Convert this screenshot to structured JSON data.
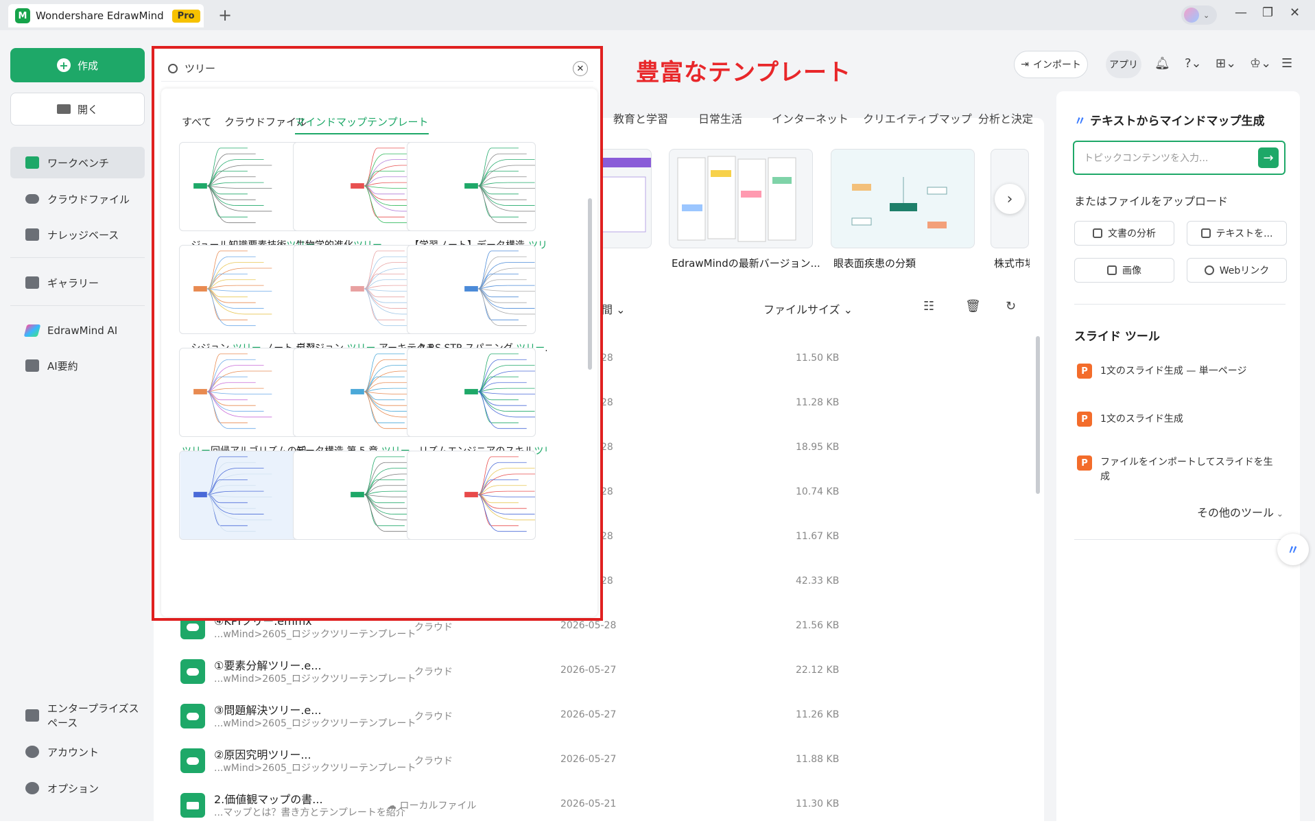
{
  "app": {
    "title": "Wondershare EdrawMind",
    "badge": "Pro"
  },
  "sidebar": {
    "create_label": "作成",
    "open_label": "開く",
    "items": [
      {
        "label": "ワークベンチ"
      },
      {
        "label": "クラウドファイル"
      },
      {
        "label": "ナレッジベース"
      },
      {
        "label": "ギャラリー"
      },
      {
        "label": "EdrawMind AI"
      },
      {
        "label": "AI要約"
      }
    ],
    "bottom": [
      {
        "label": "エンタープライズスペース"
      },
      {
        "label": "アカウント"
      },
      {
        "label": "オプション"
      }
    ]
  },
  "annotation": "豊富なテンプレート",
  "toolbar": {
    "import_label": "インポート",
    "apps_label": "アプリ"
  },
  "categories": [
    "教育と学習",
    "日常生活",
    "インターネット",
    "クリエイティブマップ",
    "分析と決定"
  ],
  "featured": [
    {
      "caption": "EdrawMindの最新バージョン..."
    },
    {
      "caption": "眼表面疾患の分類"
    },
    {
      "caption": "株式市場"
    }
  ],
  "file_list": {
    "col_time_partial": "間",
    "col_size": "ファイルサイズ",
    "hidden_sizes": [
      "11.50 KB",
      "11.28 KB",
      "18.95 KB",
      "10.74 KB",
      "11.67 KB",
      "42.33 KB"
    ],
    "hidden_dates": [
      "28",
      "28",
      "28",
      "28",
      "28",
      "28"
    ],
    "rows": [
      {
        "name": "④KPIツリー.emmx",
        "path": "...wMind>2605_ロジックツリーテンプレート",
        "location": "クラウド",
        "date": "2026-05-28",
        "size": "21.56 KB"
      },
      {
        "name": "①要素分解ツリー.e...",
        "path": "...wMind>2605_ロジックツリーテンプレート",
        "location": "クラウド",
        "date": "2026-05-27",
        "size": "22.12 KB"
      },
      {
        "name": "③問題解決ツリー.e...",
        "path": "...wMind>2605_ロジックツリーテンプレート",
        "location": "クラウド",
        "date": "2026-05-27",
        "size": "11.26 KB"
      },
      {
        "name": "②原因究明ツリー...",
        "path": "...wMind>2605_ロジックツリーテンプレート",
        "location": "クラウド",
        "date": "2026-05-27",
        "size": "11.88 KB"
      },
      {
        "name": "2.価値観マップの書...",
        "path": "...マップとは？書き方とテンプレートを紹介",
        "location": "ローカルファイル",
        "date": "2026-05-21",
        "size": "11.30 KB"
      }
    ]
  },
  "right_panel": {
    "title": "テキストからマインドマップ生成",
    "input_placeholder": "トピックコンテンツを入力...",
    "upload_label": "またはファイルをアップロード",
    "buttons": [
      "文書の分析",
      "テキストを...",
      "画像",
      "Webリンク"
    ],
    "slide_title": "スライド ツール",
    "tools": [
      "1文のスライド生成 — 単一ページ",
      "1文のスライド生成",
      "ファイルをインポートしてスライドを生 成"
    ],
    "more_label": "その他のツール"
  },
  "search_overlay": {
    "query": "ツリー",
    "tabs": [
      "すべて",
      "クラウドファイル",
      "マインドマップテンプレート"
    ],
    "active_tab": 2,
    "results": [
      {
        "pre": "...ジュール知識要素技術",
        "hl": "ツリー",
        "post": ""
      },
      {
        "pre": "生物学的進化",
        "hl": "ツリー",
        "post": ""
      },
      {
        "pre": "【学習ノート】データ構造-",
        "hl": "ツリー",
        "post": ""
      },
      {
        "pre": "...シジョン ",
        "hl": "ツリー",
        "post": " ノート 自習マ..."
      },
      {
        "pre": "デシジョン ",
        "hl": "ツリー",
        "post": " アーキテクチ..."
      },
      {
        "pre": "...A RS STP スパニング ",
        "hl": "ツリー",
        "post": "..."
      },
      {
        "pre": "",
        "hl": "ツリー",
        "post": "回帰アルゴリズムの知..."
      },
      {
        "pre": "データ構造 第 5 章 ",
        "hl": "ツリー",
        "post": ""
      },
      {
        "pre": "...リズムエンジニアのスキル",
        "hl": "ツリー",
        "post": ""
      },
      {
        "pre": "",
        "hl": "",
        "post": ""
      },
      {
        "pre": "",
        "hl": "",
        "post": ""
      },
      {
        "pre": "",
        "hl": "",
        "post": ""
      }
    ]
  },
  "colors": {
    "accent": "#1ea868",
    "highlight_border": "#e02020",
    "annotation": "#e8272a"
  }
}
